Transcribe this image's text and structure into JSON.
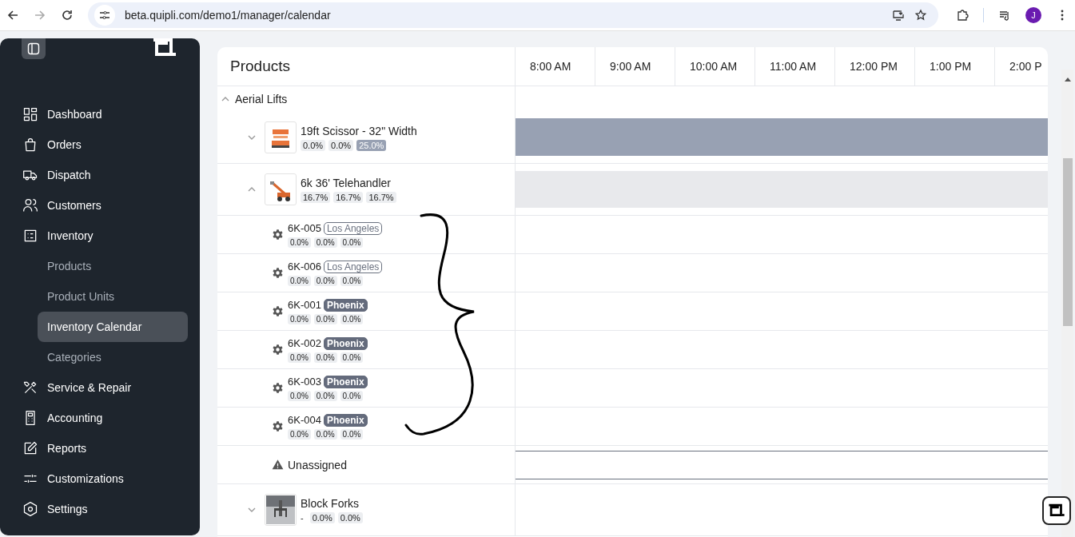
{
  "browser": {
    "url": "beta.quipli.com/demo1/manager/calendar",
    "profile_initial": "J"
  },
  "sidebar": {
    "items": [
      {
        "label": "Dashboard",
        "selected": false
      },
      {
        "label": "Orders",
        "selected": false
      },
      {
        "label": "Dispatch",
        "selected": false
      },
      {
        "label": "Customers",
        "selected": false
      },
      {
        "label": "Inventory",
        "selected": false,
        "children": [
          {
            "label": "Products",
            "selected": false
          },
          {
            "label": "Product Units",
            "selected": false
          },
          {
            "label": "Inventory Calendar",
            "selected": true
          },
          {
            "label": "Categories",
            "selected": false
          }
        ]
      },
      {
        "label": "Service & Repair",
        "selected": false
      },
      {
        "label": "Accounting",
        "selected": false
      },
      {
        "label": "Reports",
        "selected": false
      },
      {
        "label": "Customizations",
        "selected": false
      },
      {
        "label": "Settings",
        "selected": false
      }
    ]
  },
  "calendar": {
    "title": "Products",
    "time_columns": [
      "8:00 AM",
      "9:00 AM",
      "10:00 AM",
      "11:00 AM",
      "12:00 PM",
      "1:00 PM",
      "2:00 P"
    ],
    "groups": [
      {
        "name": "Aerial Lifts",
        "expanded": true,
        "products": [
          {
            "name": "19ft Scissor - 32\" Width",
            "expanded": false,
            "timeline_bar": {
              "kind": "dark"
            },
            "stats": [
              {
                "kind": "chip",
                "text": "0.0%",
                "highlighted": false
              },
              {
                "kind": "chip",
                "text": "0.0%",
                "highlighted": false
              },
              {
                "kind": "chip",
                "text": "25.0%",
                "highlighted": true
              }
            ]
          },
          {
            "name": "6k 36' Telehandler",
            "expanded": true,
            "timeline_bar": {
              "kind": "light"
            },
            "stats": [
              {
                "kind": "chip",
                "text": "16.7%",
                "highlighted": false
              },
              {
                "kind": "chip",
                "text": "16.7%",
                "highlighted": false
              },
              {
                "kind": "chip",
                "text": "16.7%",
                "highlighted": false
              }
            ],
            "units": [
              {
                "name": "6K-005",
                "location": "Los Angeles",
                "kind": "outline",
                "stats": [
                  "0.0%",
                  "0.0%",
                  "0.0%"
                ]
              },
              {
                "name": "6K-006",
                "location": "Los Angeles",
                "kind": "outline",
                "stats": [
                  "0.0%",
                  "0.0%",
                  "0.0%"
                ]
              },
              {
                "name": "6K-001",
                "location": "Phoenix",
                "kind": "filled",
                "stats": [
                  "0.0%",
                  "0.0%",
                  "0.0%"
                ]
              },
              {
                "name": "6K-002",
                "location": "Phoenix",
                "kind": "filled",
                "stats": [
                  "0.0%",
                  "0.0%",
                  "0.0%"
                ]
              },
              {
                "name": "6K-003",
                "location": "Phoenix",
                "kind": "filled",
                "stats": [
                  "0.0%",
                  "0.0%",
                  "0.0%"
                ]
              },
              {
                "name": "6K-004",
                "location": "Phoenix",
                "kind": "filled",
                "stats": [
                  "0.0%",
                  "0.0%",
                  "0.0%"
                ]
              }
            ],
            "unassigned": {
              "label": "Unassigned",
              "timeline_bar": {
                "kind": "outline"
              }
            }
          },
          {
            "name": "Block Forks",
            "expanded": false,
            "stats": [
              {
                "kind": "plain",
                "text": "-"
              },
              {
                "kind": "chip",
                "text": "0.0%",
                "highlighted": false
              },
              {
                "kind": "chip",
                "text": "0.0%",
                "highlighted": false
              }
            ]
          }
        ]
      }
    ]
  }
}
